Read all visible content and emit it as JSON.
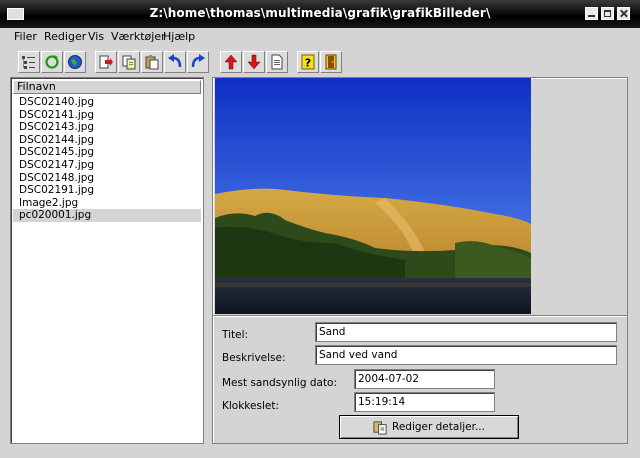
{
  "window": {
    "title": "Z:\\home\\thomas\\multimedia\\grafik\\grafikBilleder\\"
  },
  "menu": {
    "items": [
      "Filer",
      "Rediger",
      "Vis",
      "Værktøjer",
      "Hjælp"
    ]
  },
  "toolbar": {
    "icons": [
      "tree-view-icon",
      "refresh-icon",
      "globe-icon",
      "export-icon",
      "copy-icon",
      "paste-icon",
      "rotate-left-icon",
      "rotate-right-icon",
      "arrow-up-icon",
      "arrow-down-icon",
      "document-icon",
      "help-icon",
      "exit-door-icon"
    ]
  },
  "file_list": {
    "header": "Filnavn",
    "files": [
      "DSC02140.jpg",
      "DSC02141.jpg",
      "DSC02143.jpg",
      "DSC02144.jpg",
      "DSC02145.jpg",
      "DSC02147.jpg",
      "DSC02148.jpg",
      "DSC02191.jpg",
      "Image2.jpg",
      "pc020001.jpg"
    ],
    "selected_index": 9
  },
  "details": {
    "title_label": "Titel:",
    "title_value": "Sand",
    "description_label": "Beskrivelse:",
    "description_value": "Sand ved vand",
    "date_label": "Mest sandsynlig dato:",
    "date_value": "2004-07-02",
    "time_label": "Klokkeslet:",
    "time_value": "15:19:14",
    "edit_button": "Rediger detaljer..."
  },
  "colors": {
    "sky_top": "#1333c8",
    "sky_bottom": "#5a8ef0",
    "dune": "#d9a94a",
    "water": "#1c2230"
  }
}
